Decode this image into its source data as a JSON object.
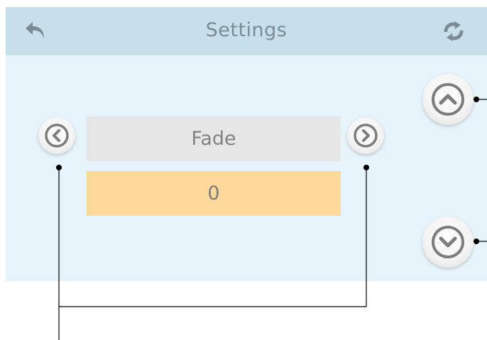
{
  "header": {
    "title": "Settings",
    "back_icon": "back-arrow-icon",
    "refresh_icon": "refresh-icon"
  },
  "selector": {
    "name": "Fade",
    "value": "0",
    "prev_icon": "chevron-left-icon",
    "next_icon": "chevron-right-icon"
  },
  "adjust": {
    "up_icon": "chevron-up-icon",
    "down_icon": "chevron-down-icon"
  },
  "colors": {
    "header_bg": "#c7dfea",
    "screen_bg": "#e6f3fa",
    "name_bg": "#e6e6e6",
    "value_bg": "#fdd89a",
    "icon": "#7b8c95"
  }
}
